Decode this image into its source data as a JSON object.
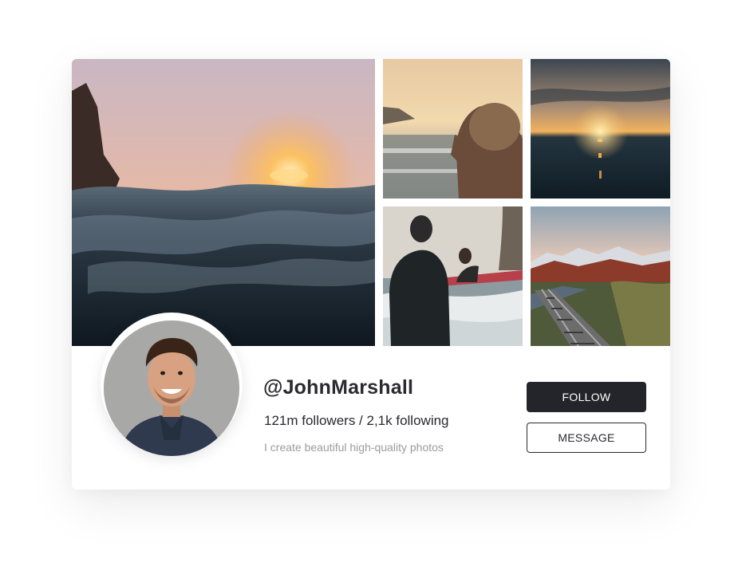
{
  "profile": {
    "username": "@JohnMarshall",
    "stats": "121m followers / 2,1k following",
    "bio": "I create beautiful high-quality photos"
  },
  "actions": {
    "follow_label": "FOLLOW",
    "message_label": "MESSAGE"
  },
  "gallery": {
    "photos": [
      "ocean-sunset-waves",
      "surfer-watching-sunset",
      "sunset-over-sea",
      "surfers-in-water",
      "mountain-railway"
    ]
  },
  "colors": {
    "primary_button": "#24252b",
    "text_dark": "#2a2a30",
    "text_muted": "#9a9aa2"
  }
}
